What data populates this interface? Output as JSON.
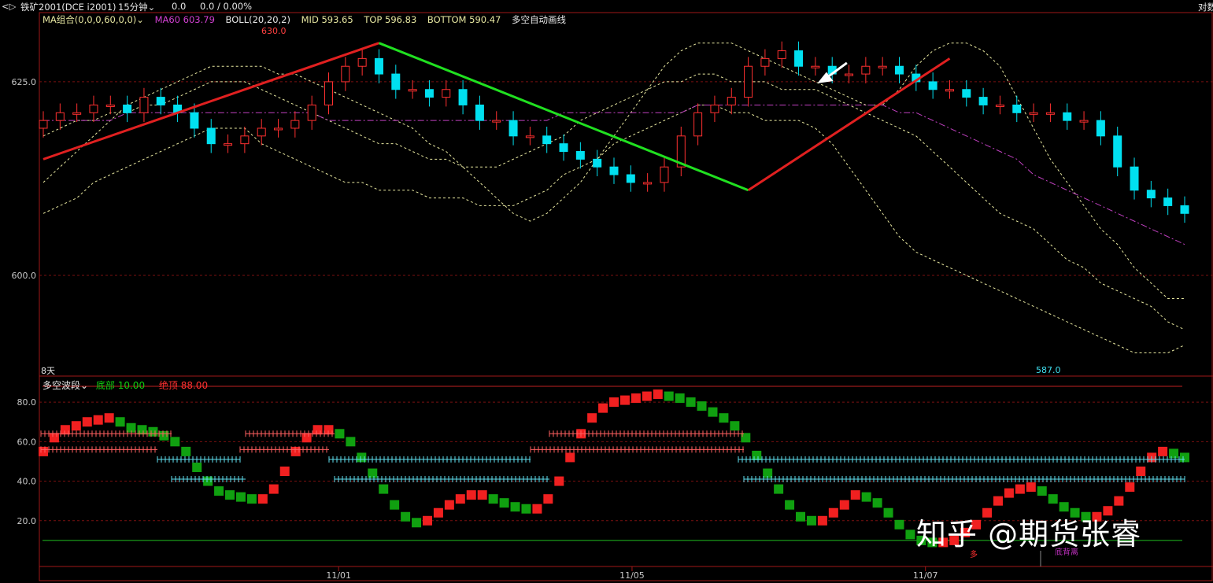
{
  "header": {
    "nav_icon": "back-forward-icon",
    "symbol": "铁矿2001(DCE i2001)",
    "period": "15分钟",
    "last": "0.0",
    "change": "0.0 / 0.00%",
    "right_label": "对数"
  },
  "indicators": {
    "ma_combo": "MA组合(0,0,0,60,0,0)",
    "ma60": "MA60 603.79",
    "boll": "BOLL(20,20,2)",
    "mid": "MID 593.65",
    "top": "TOP 596.83",
    "bottom": "BOTTOM 590.47",
    "auto_line": "多空自动画线"
  },
  "sub_panel": {
    "name": "多空波段",
    "bottom": "底部 10.00",
    "top": "绝顶 88.00",
    "mark_bottom": "底背离",
    "mark_small": "多"
  },
  "labels": {
    "days": "8天",
    "peak": "630.0",
    "low": "587.0"
  },
  "watermark": "知乎 @期货张睿",
  "colors": {
    "up": "#ff3030",
    "down": "#00e0f0",
    "boll": "#e8e8a0",
    "ma60": "#c040c0",
    "grid": "#a01818",
    "green": "#10c010"
  },
  "chart_data": [
    {
      "type": "candlestick",
      "title": "",
      "xlabel": "",
      "ylabel": "",
      "y_ticks": [
        600.0,
        625.0
      ],
      "ylim": [
        587,
        632
      ],
      "x_ticks": [
        "11/01",
        "11/05",
        "11/07"
      ],
      "series": [
        {
          "name": "BOLL TOP",
          "values": [
            612,
            614,
            616,
            618,
            620,
            622,
            623,
            624,
            625,
            626,
            627,
            627,
            627,
            627,
            626,
            626,
            625,
            624,
            623,
            622,
            621,
            620,
            619,
            617,
            616,
            614,
            612,
            610,
            608,
            607,
            608,
            610,
            612,
            615,
            618,
            621,
            624,
            627,
            629,
            630,
            630,
            630,
            629,
            628,
            627,
            626,
            625,
            624,
            623,
            622,
            622,
            624,
            627,
            629,
            630,
            630,
            629,
            627,
            623,
            619,
            615,
            612,
            609,
            606,
            604,
            601,
            599,
            597,
            597
          ]
        },
        {
          "name": "BOLL MID",
          "values": [
            618,
            619,
            620,
            620,
            621,
            621,
            622,
            622,
            623,
            624,
            625,
            625,
            625,
            624,
            623,
            622,
            621,
            620,
            619,
            618,
            617,
            617,
            616,
            615,
            615,
            614,
            614,
            614,
            615,
            616,
            617,
            618,
            620,
            621,
            622,
            623,
            624,
            625,
            625,
            626,
            626,
            625,
            625,
            625,
            624,
            624,
            624,
            623,
            622,
            621,
            620,
            619,
            618,
            616,
            614,
            612,
            610,
            608,
            607,
            606,
            604,
            602,
            601,
            599,
            598,
            597,
            596,
            594,
            593
          ]
        },
        {
          "name": "BOLL BOTTOM",
          "values": [
            608,
            609,
            610,
            612,
            613,
            614,
            615,
            616,
            617,
            618,
            619,
            619,
            619,
            617,
            616,
            615,
            614,
            613,
            612,
            612,
            611,
            611,
            611,
            610,
            610,
            610,
            609,
            609,
            609,
            610,
            611,
            613,
            614,
            615,
            617,
            618,
            619,
            620,
            621,
            622,
            622,
            621,
            621,
            620,
            620,
            620,
            619,
            617,
            614,
            611,
            608,
            605,
            603,
            602,
            601,
            600,
            599,
            598,
            597,
            596,
            595,
            594,
            593,
            592,
            591,
            590,
            590,
            590,
            591
          ]
        },
        {
          "name": "MA60",
          "values": [
            620,
            620,
            620,
            620,
            620,
            621,
            621,
            621,
            621,
            621,
            621,
            621,
            621,
            621,
            621,
            621,
            621,
            620,
            620,
            620,
            620,
            620,
            620,
            620,
            620,
            620,
            620,
            620,
            620,
            620,
            620,
            621,
            621,
            621,
            621,
            621,
            621,
            621,
            621,
            622,
            622,
            622,
            622,
            622,
            622,
            622,
            622,
            622,
            622,
            622,
            622,
            621,
            621,
            620,
            619,
            618,
            617,
            616,
            615,
            613,
            612,
            611,
            610,
            609,
            608,
            607,
            606,
            605,
            604
          ]
        },
        {
          "name": "Close",
          "values": [
            620,
            621,
            621,
            622,
            622,
            621,
            623,
            622,
            621,
            619,
            617,
            617,
            618,
            619,
            619,
            620,
            622,
            625,
            627,
            628,
            626,
            624,
            624,
            623,
            624,
            622,
            620,
            620,
            618,
            618,
            617,
            616,
            615,
            614,
            613,
            612,
            612,
            614,
            618,
            621,
            622,
            623,
            627,
            628,
            629,
            627,
            627,
            626,
            626,
            627,
            627,
            626,
            625,
            624,
            624,
            623,
            622,
            622,
            621,
            621,
            621,
            620,
            620,
            618,
            614,
            611,
            610,
            609,
            608
          ]
        }
      ],
      "candles_count": 69,
      "zigzag": [
        {
          "color": "red",
          "from": {
            "i": 0,
            "v": 615
          },
          "to": {
            "i": 20,
            "v": 630
          }
        },
        {
          "color": "green",
          "from": {
            "i": 20,
            "v": 630
          },
          "to": {
            "i": 42,
            "v": 611
          }
        },
        {
          "color": "red",
          "from": {
            "i": 42,
            "v": 611
          },
          "to": {
            "i": 54,
            "v": 628
          }
        }
      ]
    },
    {
      "type": "bar",
      "title": "",
      "xlabel": "",
      "ylabel": "",
      "y_ticks": [
        20.0,
        40.0,
        60.0,
        80.0
      ],
      "ylim": [
        0,
        90
      ],
      "reference_lines": [
        10,
        88
      ],
      "series": [
        {
          "name": "多空波段",
          "values": [
            55,
            62,
            66,
            68,
            70,
            71,
            72,
            70,
            67,
            66,
            65,
            63,
            60,
            55,
            47,
            40,
            35,
            33,
            32,
            31,
            31,
            36,
            45,
            55,
            62,
            66,
            66,
            64,
            60,
            52,
            44,
            36,
            28,
            22,
            19,
            20,
            24,
            28,
            31,
            33,
            33,
            31,
            29,
            27,
            26,
            26,
            31,
            40,
            52,
            64,
            72,
            77,
            80,
            81,
            82,
            83,
            84,
            83,
            82,
            80,
            78,
            75,
            72,
            68,
            62,
            53,
            44,
            36,
            28,
            22,
            20,
            20,
            24,
            28,
            33,
            32,
            29,
            24,
            18,
            13,
            10,
            9,
            9,
            10,
            14,
            18,
            24,
            30,
            34,
            36,
            37,
            35,
            31,
            27,
            24,
            22,
            22,
            25,
            30,
            37,
            45,
            52,
            55,
            54,
            52
          ]
        }
      ]
    }
  ]
}
